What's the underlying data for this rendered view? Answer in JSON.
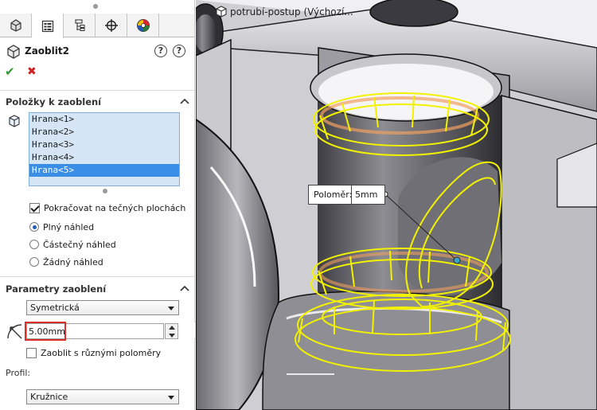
{
  "document": {
    "title": "potrubí-postup  (Výchozí..."
  },
  "tabs": [
    {
      "icon": "feature-manager-icon"
    },
    {
      "icon": "property-manager-icon",
      "active": true
    },
    {
      "icon": "configuration-manager-icon"
    },
    {
      "icon": "dimxpert-manager-icon"
    },
    {
      "icon": "display-manager-icon"
    }
  ],
  "feature": {
    "title": "Zaoblit2"
  },
  "items_section": {
    "title": "Položky k zaoblení",
    "edges": [
      "Hrana<1>",
      "Hrana<2>",
      "Hrana<3>",
      "Hrana<4>",
      "Hrana<5>"
    ],
    "selected_index": 4,
    "tangent_label": "Pokračovat na tečných plochách",
    "tangent_checked": true,
    "preview_full": "Plný náhled",
    "preview_partial": "Částečný náhled",
    "preview_none": "Žádný náhled",
    "preview_selected": "full"
  },
  "params_section": {
    "title": "Parametry zaoblení",
    "type_value": "Symetrická",
    "radius_value": "5.00mm",
    "variable_label": "Zaoblit s různými poloměry",
    "variable_checked": false,
    "profile_label": "Profil:",
    "profile_value": "Kružnice"
  },
  "callout": {
    "label": "Poloměr:",
    "value": "5mm"
  },
  "colors": {
    "edge_highlight": "#f2f200",
    "selection_blue": "#3a8ee6",
    "accent_red": "#d9302c"
  }
}
